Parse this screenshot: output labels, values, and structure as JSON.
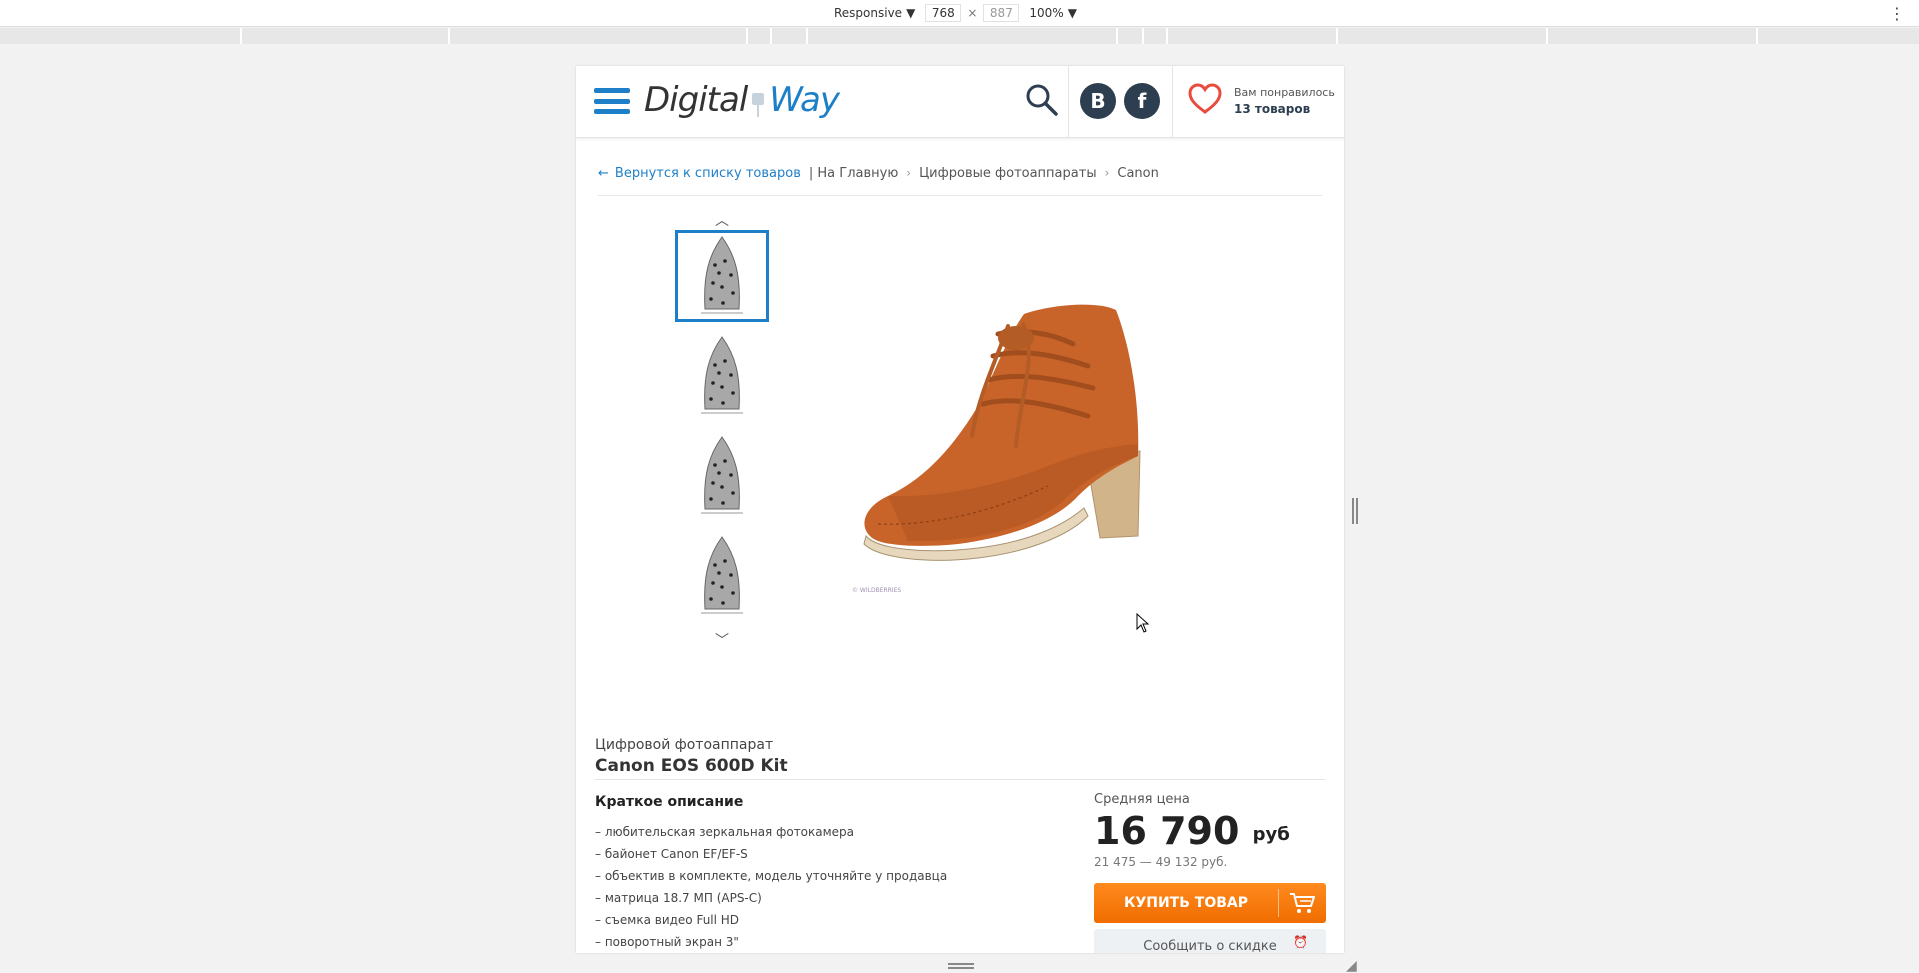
{
  "devtools": {
    "device_mode": "Responsive",
    "width": "768",
    "times": "×",
    "height": "887",
    "zoom": "100%"
  },
  "header": {
    "logo_left": "Digital",
    "logo_right": "Way",
    "vk_label": "B",
    "fb_label": "f",
    "fav_line1": "Вам понравилось",
    "fav_line2": "13 товаров"
  },
  "breadcrumbs": {
    "back": "Вернутся к списку товаров",
    "items": [
      "| На Главную",
      "Цифровые фотоаппараты",
      "Canon"
    ]
  },
  "gallery": {
    "watermark": "© WILDBERRIES"
  },
  "product": {
    "category": "Цифровой фотоаппарат",
    "name": "Canon EOS 600D Kit",
    "short_desc_title": "Краткое описание",
    "features": [
      "– любительская зеркальная фотокамера",
      "– байонет Canon EF/EF-S",
      "– объектив в комплекте, модель уточняйте у продавца",
      "– матрица 18.7 МП (APS-C)",
      "– съемка видео Full HD",
      "– поворотный экран 3\""
    ]
  },
  "price": {
    "avg_label": "Средняя цена",
    "value": "16 790",
    "currency": "руб",
    "range": "21 475 — 49 132 руб.",
    "buy_label": "КУПИТЬ ТОВАР",
    "notify_label": "Сообщить о скидке"
  },
  "colors": {
    "accent": "#1e7fc9",
    "buy": "#f57a0a",
    "social": "#2c3e50",
    "heart": "#e84c3d"
  }
}
